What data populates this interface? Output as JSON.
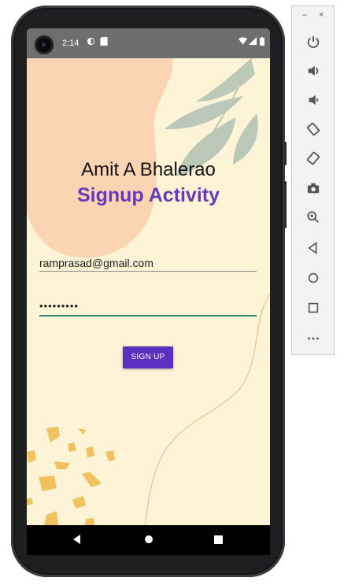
{
  "status_bar": {
    "time": "2:14",
    "icons": [
      "camera-cutout",
      "data-saver-icon",
      "sd-card-icon",
      "wifi-icon",
      "signal-icon",
      "battery-icon"
    ]
  },
  "app": {
    "name_title": "Amit A Bhalerao",
    "activity_title": "Signup Activity",
    "email_value": "ramprasad@gmail.com",
    "password_value": "•••••••••",
    "signup_label": "SIGN UP"
  },
  "nav_bar": {
    "buttons": [
      "back",
      "home",
      "recents"
    ]
  },
  "toolbar": {
    "window_controls": {
      "minimize": "–",
      "close": "×"
    },
    "buttons": [
      "power",
      "volume-up",
      "volume-down",
      "rotate-left",
      "rotate-right",
      "screenshot",
      "zoom",
      "back",
      "home",
      "overview",
      "more"
    ]
  },
  "colors": {
    "screen_bg": "#fdf3d6",
    "accent_purple": "#673ab7",
    "button_purple": "#5b2fbf",
    "blob_peach": "#fbd5b3",
    "leaf_green": "#b6c4b4",
    "dots_yellow": "#f0c15c",
    "field_underline_focus": "#2e8b6f"
  }
}
